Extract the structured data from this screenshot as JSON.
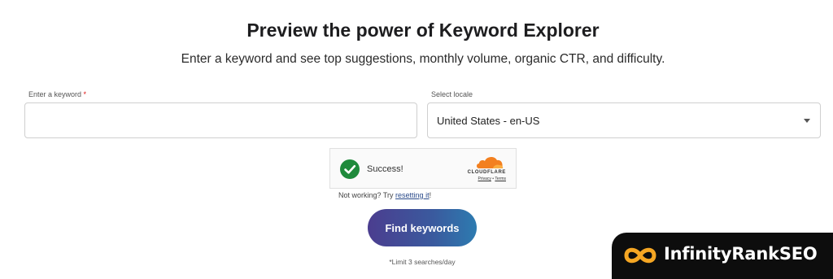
{
  "header": {
    "title": "Preview the power of Keyword Explorer",
    "subtitle": "Enter a keyword and see top suggestions, monthly volume, organic CTR, and difficulty."
  },
  "form": {
    "keyword": {
      "label": "Enter a keyword",
      "required_mark": "*",
      "value": "",
      "placeholder": ""
    },
    "locale": {
      "label": "Select locale",
      "selected": "United States - en-US",
      "icon": "chevron-down-icon"
    }
  },
  "captcha": {
    "status": "Success!",
    "status_icon": "check-circle-icon",
    "status_color": "#1f8a3b",
    "provider": "CLOUDFLARE",
    "provider_color": "#f38020",
    "privacy_label": "Privacy",
    "separator": "•",
    "terms_label": "Terms",
    "help_prefix": "Not working? Try",
    "help_link": "resetting it",
    "help_suffix": "!"
  },
  "actions": {
    "find_label": "Find keywords",
    "limit_note": "*Limit 3 searches/day"
  },
  "watermark": {
    "brand_name": "InfinityRankSEO",
    "logo_icon": "infinity-logo-icon",
    "logo_color": "#f5a623"
  }
}
